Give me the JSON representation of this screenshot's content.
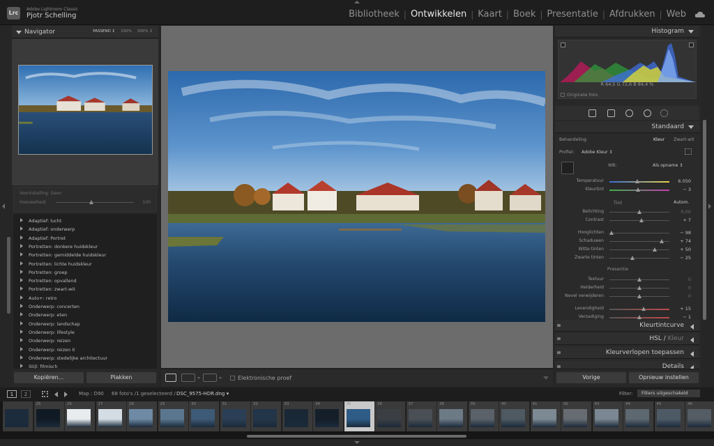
{
  "app": {
    "logo": "Lrc",
    "name": "Adobe Lightroom Classic",
    "user": "Pjotr Schelling",
    "modules": [
      "Bibliotheek",
      "Ontwikkelen",
      "Kaart",
      "Boek",
      "Presentatie",
      "Afdrukken",
      "Web"
    ],
    "active_module": "Ontwikkelen"
  },
  "navigator": {
    "title": "Navigator",
    "zoom_options": [
      "PASSEND ↕",
      "100%",
      "300% ↕"
    ]
  },
  "preset_amount": {
    "label": "Voorinstelling: Geen",
    "amount_label": "Hoeveelheid",
    "amount_value": "100"
  },
  "presets": [
    "Adaptief: lucht",
    "Adaptief: onderwerp",
    "Adaptief: Portret",
    "Portretten: donkere huidskleur",
    "Portretten: gemiddelde huidskleur",
    "Portretten: lichte huidskleur",
    "Portretten: groep",
    "Portretten: opvallend",
    "Portretten: zwart-wit",
    "Auto+: retro",
    "Onderwerp: concerten",
    "Onderwerp: eten",
    "Onderwerp: landschap",
    "Onderwerp: lifestyle",
    "Onderwerp: reizen",
    "Onderwerp: reizen II",
    "Onderwerp: stedelijke architectuur",
    "Stijl: filmisch"
  ],
  "left_buttons": {
    "copy": "Kopiëren...",
    "paste": "Plakken"
  },
  "toolbar": {
    "proof": "Elektronische proef"
  },
  "histogram": {
    "title": "Histogram",
    "r": "R  64,5  %",
    "g": "G  72,6  %",
    "b": "B  84,4  %",
    "rgb_line": "R   64,5   G   72,6   B   84,4   %",
    "original": "Originele foto"
  },
  "basic": {
    "preset_title": "Standaard",
    "treatment_label": "Behandeling:",
    "treatment_color": "Kleur",
    "treatment_bw": "Zwart-wit",
    "profile_label": "Profiel:",
    "profile_value": "Adobe Kleur ↕",
    "wb_label": "WB:",
    "wb_value": "Als opname ↕",
    "tone_label": "Tint",
    "auto_label": "Autom.",
    "presence_label": "Presentie",
    "sliders": [
      {
        "label": "Temperatuur",
        "value": "6.050",
        "pos": 0.47
      },
      {
        "label": "Kleurtint",
        "value": "− 3",
        "pos": 0.48
      },
      {
        "label": "Belichting",
        "value": "0,00",
        "pos": 0.5
      },
      {
        "label": "Contrast",
        "value": "+ 7",
        "pos": 0.53
      },
      {
        "label": "Hooglichten",
        "value": "− 98",
        "pos": 0.03
      },
      {
        "label": "Schaduwen",
        "value": "+ 74",
        "pos": 0.87
      },
      {
        "label": "Witte tinten",
        "value": "+ 50",
        "pos": 0.75
      },
      {
        "label": "Zwarte tinten",
        "value": "− 25",
        "pos": 0.38
      },
      {
        "label": "Textuur",
        "value": "0",
        "pos": 0.5
      },
      {
        "label": "Helderheid",
        "value": "0",
        "pos": 0.5
      },
      {
        "label": "Nevel verwijderen",
        "value": "0",
        "pos": 0.5
      },
      {
        "label": "Levendigheid",
        "value": "+ 15",
        "pos": 0.57
      },
      {
        "label": "Verzadiging",
        "value": "− 1",
        "pos": 0.5
      }
    ]
  },
  "sections": {
    "color_grading": "Kleurtintcurve",
    "hsl": "HSL",
    "hsl_color": "Kleur",
    "gradients": "Kleurverlopen toepassen",
    "details": "Details"
  },
  "right_buttons": {
    "previous": "Vorige",
    "reset": "Opnieuw instellen"
  },
  "filmstrip_bar": {
    "page1": "1",
    "page2": "2",
    "source": "Map : D90",
    "count": "68 foto's /1 geselecteerd /",
    "file": "DSC_9575-HDR.dng ▾",
    "filter_label": "Filter:",
    "filter_value": "Filters uitgeschakeld"
  },
  "filmstrip_numbers": [
    "",
    "25",
    "26",
    "27",
    "28",
    "29",
    "30",
    "31",
    "32",
    "33",
    "34",
    "35",
    "36",
    "37",
    "38",
    "39",
    "40",
    "41",
    "42",
    "43",
    "44",
    "45",
    "46"
  ],
  "colors": {
    "accent": "#d8d8d8",
    "panel": "#282828",
    "background": "#262626",
    "canvas": "#6c6c6c"
  }
}
